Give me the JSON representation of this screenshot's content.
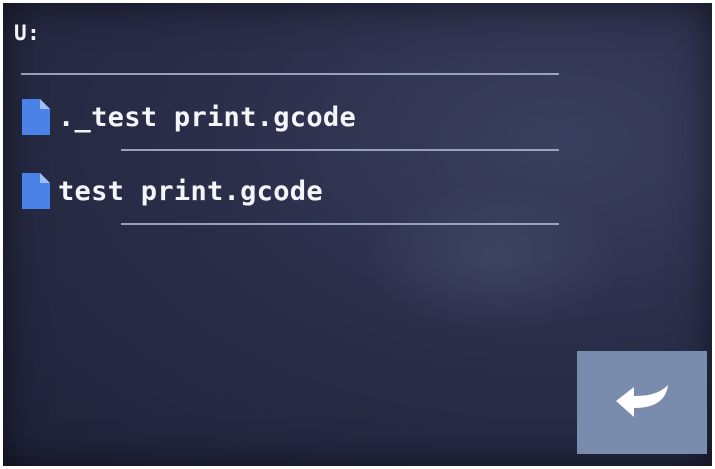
{
  "header": {
    "path": "U:"
  },
  "files": [
    {
      "name": "._test print.gcode",
      "icon": "file-icon"
    },
    {
      "name": "test print.gcode",
      "icon": "file-icon"
    }
  ],
  "back_button": {
    "icon": "return-arrow-icon"
  },
  "colors": {
    "background": "#2a2e49",
    "text": "#f4f5f8",
    "divider": "#a9b6d0",
    "file_icon": "#4a82e8",
    "back_button": "#7a8cae"
  }
}
